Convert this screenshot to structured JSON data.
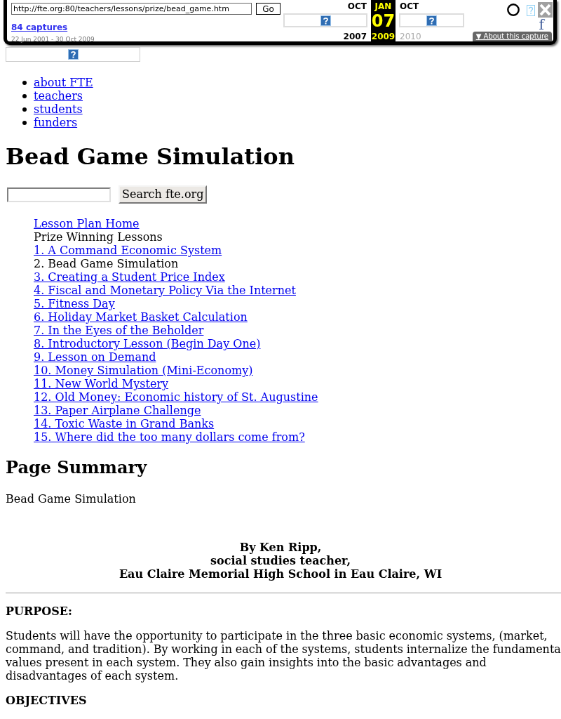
{
  "toolbar": {
    "url": "http://fte.org:80/teachers/lessons/prize/bead_game.htm",
    "go_button": "Go",
    "captures_link": "84 captures",
    "date_range": "22 Jun 2001 - 30 Oct 2009",
    "timeline": [
      {
        "month": "OCT",
        "year": "2007",
        "selected": false,
        "disabled": false
      },
      {
        "month": "JAN",
        "day": "07",
        "year": "2009",
        "selected": true,
        "disabled": false
      },
      {
        "month": "OCT",
        "year": "2010",
        "selected": false,
        "disabled": true
      }
    ],
    "share_label": "f",
    "about_button": "▼ About this capture"
  },
  "nav_links": [
    "about FTE",
    "teachers",
    "students",
    "funders"
  ],
  "title": "Bead Game Simulation",
  "search": {
    "button": "Search fte.org"
  },
  "lessons": [
    {
      "label": "Lesson Plan Home",
      "kind": "link"
    },
    {
      "label": "Prize Winning Lessons",
      "kind": "text"
    },
    {
      "label": "1. A Command Economic System",
      "kind": "link"
    },
    {
      "label": "2. Bead Game Simulation",
      "kind": "text"
    },
    {
      "label": "3. Creating a Student Price Index",
      "kind": "link"
    },
    {
      "label": "4. Fiscal and Monetary Policy Via the Internet",
      "kind": "link"
    },
    {
      "label": "5. Fitness Day",
      "kind": "link"
    },
    {
      "label": "6. Holiday Market Basket Calculation",
      "kind": "link"
    },
    {
      "label": "7. In the Eyes of the Beholder",
      "kind": "link"
    },
    {
      "label": "8. Introductory Lesson (Begin Day One)",
      "kind": "link"
    },
    {
      "label": "9. Lesson on Demand",
      "kind": "link"
    },
    {
      "label": "10. Money Simulation (Mini-Economy)",
      "kind": "link"
    },
    {
      "label": "11. New World Mystery",
      "kind": "link"
    },
    {
      "label": "12. Old Money: Economic history of St. Augustine",
      "kind": "link"
    },
    {
      "label": "13. Paper Airplane Challenge",
      "kind": "link"
    },
    {
      "label": "14. Toxic Waste in Grand Banks",
      "kind": "link"
    },
    {
      "label": "15. Where did the too many dollars come from?",
      "kind": "link"
    }
  ],
  "summary": {
    "heading": "Page Summary",
    "text": "Bead Game Simulation"
  },
  "byline": [
    "By Ken Ripp,",
    "social studies teacher,",
    "Eau Claire Memorial High School in Eau Claire, WI"
  ],
  "sections": [
    {
      "heading": "PURPOSE:",
      "text": "Students will have the opportunity to participate in the three basic economic systems, (market, command, and tradition). By working in each of the systems, students internalize the fundamenta values present in each system. They also gain insights into the basic advantages and disadvantages of each system."
    },
    {
      "heading": "OBJECTIVES"
    }
  ]
}
